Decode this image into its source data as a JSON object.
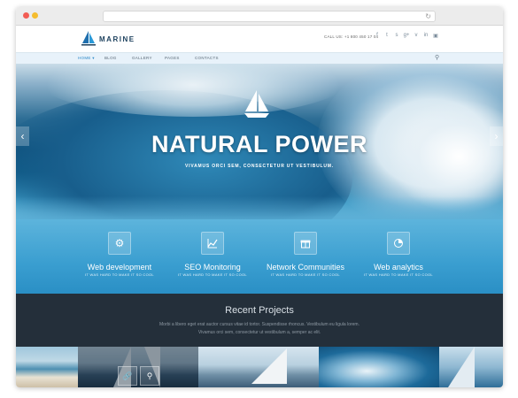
{
  "header": {
    "logo_text": "MARINE",
    "call_us": "CALL US: +1 800 450 17 04",
    "social_icons": [
      "facebook-icon",
      "twitter-icon",
      "skype-icon",
      "google-plus-icon",
      "vimeo-icon",
      "linkedin-icon",
      "instagram-icon"
    ]
  },
  "nav": {
    "items": [
      {
        "label": "HOME",
        "active": true
      },
      {
        "label": "BLOG",
        "active": false
      },
      {
        "label": "GALLERY",
        "active": false
      },
      {
        "label": "PAGES",
        "active": false
      },
      {
        "label": "CONTACTS",
        "active": false
      }
    ]
  },
  "hero": {
    "title": "NATURAL POWER",
    "subtitle": "VIVAMUS ORCI SEM, CONSECTETUR UT VESTIBULUM."
  },
  "features": [
    {
      "title": "Web development",
      "subtitle": "IT WAS HARD TO MAKE IT SO COOL",
      "icon": "gear-icon"
    },
    {
      "title": "SEO Monitoring",
      "subtitle": "IT WAS HARD TO MAKE IT SO COOL",
      "icon": "chart-icon"
    },
    {
      "title": "Network Communities",
      "subtitle": "IT WAS HARD TO MAKE IT SO COOL",
      "icon": "gift-icon"
    },
    {
      "title": "Web analytics",
      "subtitle": "IT WAS HARD TO MAKE IT SO COOL",
      "icon": "pie-chart-icon"
    }
  ],
  "projects": {
    "title": "Recent Projects",
    "text_line1": "Morbi a libero eget erat auctor cursus vitae id tortor. Suspendisse rhoncus. Vestibulum eu ligula lorem.",
    "text_line2": "Vivamus orci sem, consectetur ut vestibulum a, semper ac elit."
  },
  "colors": {
    "accent": "#2b88c8",
    "dark_section": "#242f3a",
    "feature_blue": "#3a9ed0"
  }
}
